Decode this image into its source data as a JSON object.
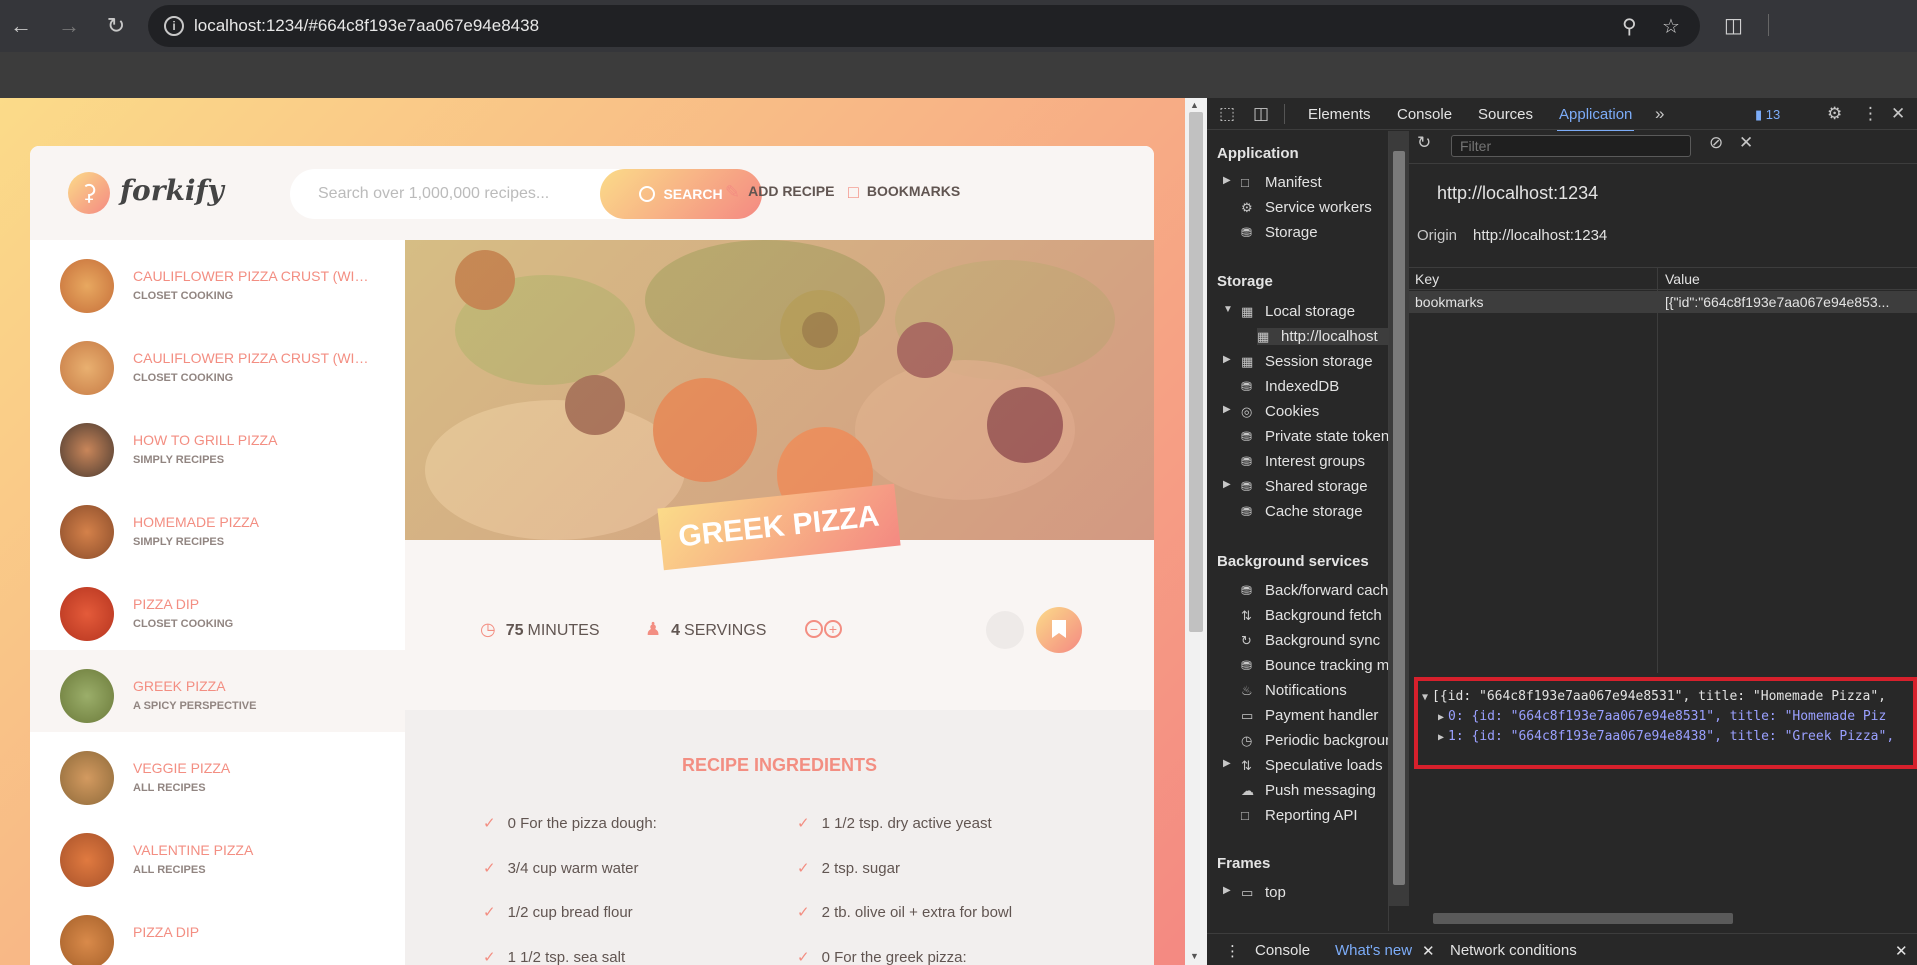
{
  "browser": {
    "url": "localhost:1234/#664c8f193e7aa067e94e8438",
    "back_icon": "arrow-left-icon",
    "forward_icon": "arrow-right-icon",
    "reload_icon": "reload-icon"
  },
  "app": {
    "logo_text": "forkify",
    "search_placeholder": "Search over 1,000,000 recipes...",
    "search_button": "SEARCH",
    "add_recipe": "ADD RECIPE",
    "bookmarks": "BOOKMARKS"
  },
  "results": [
    {
      "title": "CAULIFLOWER PIZZA CRUST (WIT...",
      "publisher": "CLOSET COOKING"
    },
    {
      "title": "CAULIFLOWER PIZZA CRUST (WIT...",
      "publisher": "CLOSET COOKING"
    },
    {
      "title": "HOW TO GRILL PIZZA",
      "publisher": "SIMPLY RECIPES"
    },
    {
      "title": "HOMEMADE PIZZA",
      "publisher": "SIMPLY RECIPES"
    },
    {
      "title": "PIZZA DIP",
      "publisher": "CLOSET COOKING"
    },
    {
      "title": "GREEK PIZZA",
      "publisher": "A SPICY PERSPECTIVE",
      "active": true
    },
    {
      "title": "VEGGIE PIZZA",
      "publisher": "ALL RECIPES"
    },
    {
      "title": "VALENTINE PIZZA",
      "publisher": "ALL RECIPES"
    },
    {
      "title": "PIZZA DIP",
      "publisher": ""
    }
  ],
  "recipe": {
    "title": "GREEK PIZZA",
    "minutes": "75",
    "minutes_label": "MINUTES",
    "servings": "4",
    "servings_label": "SERVINGS",
    "ingredients_heading": "RECIPE INGREDIENTS",
    "ingredients": [
      "0 For the pizza dough:",
      "1 1/2 tsp. dry active yeast",
      "3/4 cup warm water",
      "2 tsp. sugar",
      "1/2 cup bread flour",
      "2 tb. olive oil + extra for bowl",
      "1 1/2 tsp. sea salt",
      "0 For the greek pizza:"
    ]
  },
  "devtools": {
    "tabs": [
      "Elements",
      "Console",
      "Sources",
      "Application"
    ],
    "selected_tab": "Application",
    "issues_count": "13",
    "filter_placeholder": "Filter",
    "sidebar": {
      "application_heading": "Application",
      "application_items": [
        "Manifest",
        "Service workers",
        "Storage"
      ],
      "storage_heading": "Storage",
      "storage_items": [
        "Local storage",
        "http://localhost",
        "Session storage",
        "IndexedDB",
        "Cookies",
        "Private state tokens",
        "Interest groups",
        "Shared storage",
        "Cache storage"
      ],
      "background_heading": "Background services",
      "background_items": [
        "Back/forward cache",
        "Background fetch",
        "Background sync",
        "Bounce tracking mitigations",
        "Notifications",
        "Payment handler",
        "Periodic background sync",
        "Speculative loads",
        "Push messaging",
        "Reporting API"
      ],
      "frames_heading": "Frames",
      "frames_items": [
        "top"
      ]
    },
    "origin_title": "http://localhost:1234",
    "origin_label": "Origin",
    "origin_value": "http://localhost:1234",
    "table": {
      "key_header": "Key",
      "value_header": "Value",
      "row_key": "bookmarks",
      "row_value": "[{\"id\":\"664c8f193e7aa067e94e853..."
    },
    "preview": [
      "[{id: \"664c8f193e7aa067e94e8531\", title: \"Homemade Pizza\",",
      "0: {id: \"664c8f193e7aa067e94e8531\", title: \"Homemade Piz",
      "1: {id: \"664c8f193e7aa067e94e8438\", title: \"Greek Pizza\","
    ],
    "drawer": [
      "Console",
      "What's new",
      "Network conditions"
    ]
  }
}
